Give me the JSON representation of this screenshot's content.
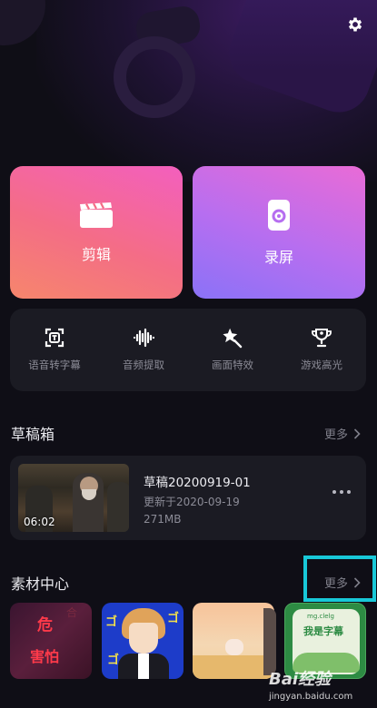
{
  "settings": {
    "icon": "gear-icon"
  },
  "cards": {
    "edit": {
      "label": "剪辑",
      "icon": "clapperboard-icon"
    },
    "record": {
      "label": "录屏",
      "icon": "screen-record-icon"
    }
  },
  "tools": [
    {
      "label": "语音转字幕",
      "icon": "text-recognize-icon"
    },
    {
      "label": "音频提取",
      "icon": "audio-wave-icon"
    },
    {
      "label": "画面特效",
      "icon": "magic-wand-icon"
    },
    {
      "label": "游戏高光",
      "icon": "trophy-icon"
    }
  ],
  "drafts": {
    "title": "草稿箱",
    "more": "更多",
    "item": {
      "duration": "06:02",
      "name": "草稿20200919-01",
      "updated": "更新于2020-09-19",
      "size": "271MB"
    }
  },
  "materials": {
    "title": "素材中心",
    "more": "更多",
    "tile1": {
      "line1": "危",
      "line2": "害怕",
      "corner": "合"
    },
    "tile4": {
      "small": "mg.clelg",
      "title": "我是字幕"
    }
  },
  "watermark": {
    "brand": "Bai经验",
    "url": "jingyan.baidu.com"
  },
  "colors": {
    "highlight": "#18c8d8",
    "background": "#0f0e16",
    "panel": "#1b1b23"
  }
}
